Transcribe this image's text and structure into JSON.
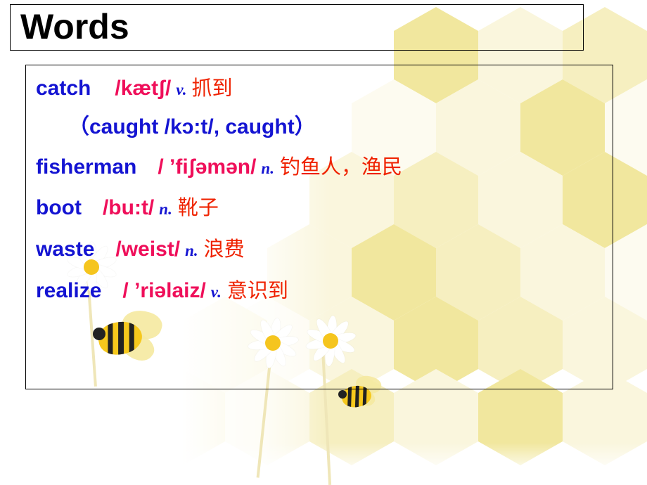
{
  "slide": {
    "title": "Words",
    "background_theme": "honeycomb-daisies-bees",
    "colors": {
      "english_word": "#1414d2",
      "phonetic": "#ef0f5a",
      "part_of_speech": "#1414d2",
      "chinese_meaning": "#ef2200",
      "border": "#000000",
      "page_background": "#ffffff",
      "honeycomb": "#f6efc0",
      "bee_yellow": "#f6c81c",
      "daisy_core": "#f5c51e"
    }
  },
  "words": [
    {
      "english": "catch",
      "gap1": "   ",
      "phonetic": "/kætʃ/",
      "gap2": " ",
      "pos": "v.",
      "gap3": " ",
      "chinese": "抓到",
      "extra": ""
    },
    {
      "english": "",
      "gap1": "",
      "phonetic": "",
      "gap2": "",
      "pos": "",
      "gap3": "",
      "chinese": "",
      "extra": "（caught /kɔ:t/, caught）"
    },
    {
      "english": "fisherman",
      "gap1": "   ",
      "phonetic": "/ ’fiʃəmən/",
      "gap2": " ",
      "pos": "n.",
      "gap3": " ",
      "chinese": "钓鱼人，渔民",
      "extra": ""
    },
    {
      "english": "boot",
      "gap1": "   ",
      "phonetic": "/bu:t/",
      "gap2": " ",
      "pos": "n.",
      "gap3": " ",
      "chinese": "靴子",
      "extra": ""
    },
    {
      "english": "waste",
      "gap1": "   ",
      "phonetic": "/weist/",
      "gap2": " ",
      "pos": "n.",
      "gap3": " ",
      "chinese": "浪费",
      "extra": ""
    },
    {
      "english": "realize",
      "gap1": "   ",
      "phonetic": "/ ’riəlaiz/",
      "gap2": " ",
      "pos": "v.",
      "gap3": " ",
      "chinese": "意识到",
      "extra": ""
    }
  ]
}
